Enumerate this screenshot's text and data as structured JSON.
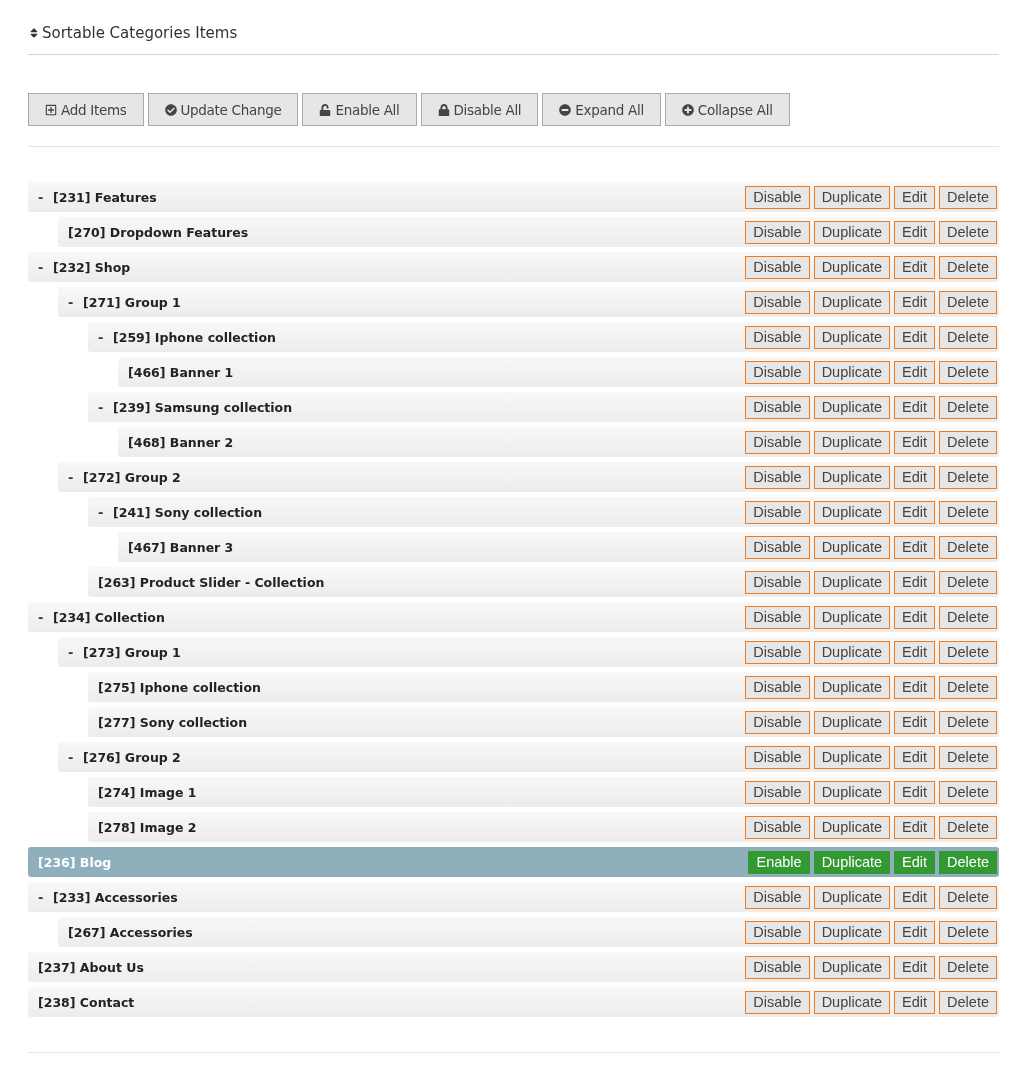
{
  "title": "Sortable Categories Items",
  "toolbar": [
    {
      "kind": "add",
      "label": "Add Items"
    },
    {
      "kind": "update",
      "label": "Update Change"
    },
    {
      "kind": "enable",
      "label": "Enable All"
    },
    {
      "kind": "disable",
      "label": "Disable All"
    },
    {
      "kind": "expand",
      "label": "Expand All"
    },
    {
      "kind": "collapse",
      "label": "Collapse All"
    }
  ],
  "items": [
    {
      "label": "[231] Features",
      "toggle": "-",
      "disabled": false,
      "actions": [
        "Disable",
        "Duplicate",
        "Edit",
        "Delete"
      ],
      "children": [
        {
          "label": "[270] Dropdown Features",
          "disabled": false,
          "actions": [
            "Disable",
            "Duplicate",
            "Edit",
            "Delete"
          ]
        }
      ]
    },
    {
      "label": "[232] Shop",
      "toggle": "-",
      "disabled": false,
      "actions": [
        "Disable",
        "Duplicate",
        "Edit",
        "Delete"
      ],
      "children": [
        {
          "label": "[271] Group 1",
          "toggle": "-",
          "disabled": false,
          "actions": [
            "Disable",
            "Duplicate",
            "Edit",
            "Delete"
          ],
          "children": [
            {
              "label": "[259] Iphone collection",
              "toggle": "-",
              "disabled": false,
              "actions": [
                "Disable",
                "Duplicate",
                "Edit",
                "Delete"
              ],
              "children": [
                {
                  "label": "[466] Banner 1",
                  "disabled": false,
                  "actions": [
                    "Disable",
                    "Duplicate",
                    "Edit",
                    "Delete"
                  ]
                }
              ]
            },
            {
              "label": "[239] Samsung collection",
              "toggle": "-",
              "disabled": false,
              "actions": [
                "Disable",
                "Duplicate",
                "Edit",
                "Delete"
              ],
              "children": [
                {
                  "label": "[468] Banner 2",
                  "disabled": false,
                  "actions": [
                    "Disable",
                    "Duplicate",
                    "Edit",
                    "Delete"
                  ]
                }
              ]
            }
          ]
        },
        {
          "label": "[272] Group 2",
          "toggle": "-",
          "disabled": false,
          "actions": [
            "Disable",
            "Duplicate",
            "Edit",
            "Delete"
          ],
          "children": [
            {
              "label": "[241] Sony collection",
              "toggle": "-",
              "disabled": false,
              "actions": [
                "Disable",
                "Duplicate",
                "Edit",
                "Delete"
              ],
              "children": [
                {
                  "label": "[467] Banner 3",
                  "disabled": false,
                  "actions": [
                    "Disable",
                    "Duplicate",
                    "Edit",
                    "Delete"
                  ]
                }
              ]
            },
            {
              "label": "[263] Product Slider - Collection",
              "disabled": false,
              "actions": [
                "Disable",
                "Duplicate",
                "Edit",
                "Delete"
              ]
            }
          ]
        }
      ]
    },
    {
      "label": "[234] Collection",
      "toggle": "-",
      "disabled": false,
      "actions": [
        "Disable",
        "Duplicate",
        "Edit",
        "Delete"
      ],
      "children": [
        {
          "label": "[273] Group 1",
          "toggle": "-",
          "disabled": false,
          "actions": [
            "Disable",
            "Duplicate",
            "Edit",
            "Delete"
          ],
          "children": [
            {
              "label": "[275] Iphone collection",
              "disabled": false,
              "actions": [
                "Disable",
                "Duplicate",
                "Edit",
                "Delete"
              ]
            },
            {
              "label": "[277] Sony collection",
              "disabled": false,
              "actions": [
                "Disable",
                "Duplicate",
                "Edit",
                "Delete"
              ]
            }
          ]
        },
        {
          "label": "[276] Group 2",
          "toggle": "-",
          "disabled": false,
          "actions": [
            "Disable",
            "Duplicate",
            "Edit",
            "Delete"
          ],
          "children": [
            {
              "label": "[274] Image 1",
              "disabled": false,
              "actions": [
                "Disable",
                "Duplicate",
                "Edit",
                "Delete"
              ]
            },
            {
              "label": "[278] Image 2",
              "disabled": false,
              "actions": [
                "Disable",
                "Duplicate",
                "Edit",
                "Delete"
              ]
            }
          ]
        }
      ]
    },
    {
      "label": "[236] Blog",
      "disabled": true,
      "actions": [
        "Enable",
        "Duplicate",
        "Edit",
        "Delete"
      ]
    },
    {
      "label": "[233] Accessories",
      "toggle": "-",
      "disabled": false,
      "actions": [
        "Disable",
        "Duplicate",
        "Edit",
        "Delete"
      ],
      "children": [
        {
          "label": "[267] Accessories",
          "disabled": false,
          "actions": [
            "Disable",
            "Duplicate",
            "Edit",
            "Delete"
          ]
        }
      ]
    },
    {
      "label": "[237] About Us",
      "disabled": false,
      "actions": [
        "Disable",
        "Duplicate",
        "Edit",
        "Delete"
      ]
    },
    {
      "label": "[238] Contact",
      "disabled": false,
      "actions": [
        "Disable",
        "Duplicate",
        "Edit",
        "Delete"
      ]
    }
  ]
}
